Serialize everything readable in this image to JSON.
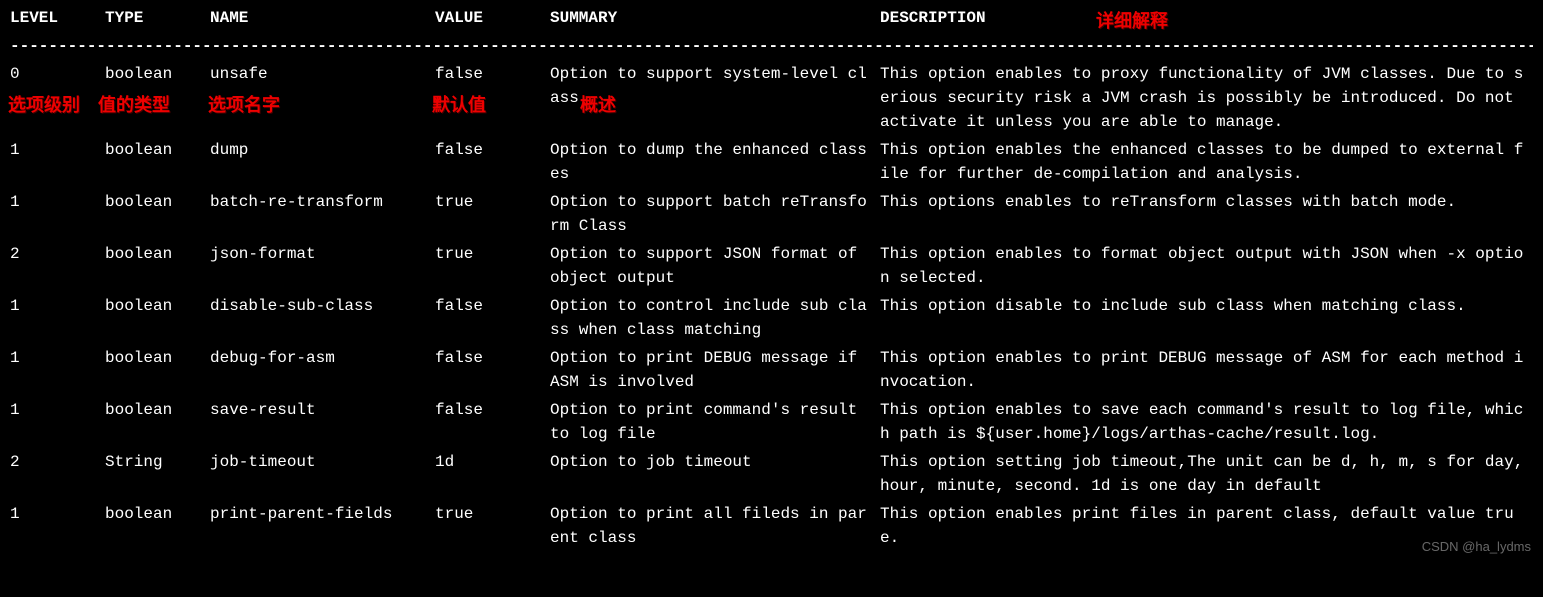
{
  "headers": {
    "level": "LEVEL",
    "type": "TYPE",
    "name": "NAME",
    "value": "VALUE",
    "summary": "SUMMARY",
    "description": "DESCRIPTION"
  },
  "rows": [
    {
      "level": "0",
      "type": "boolean",
      "name": "unsafe",
      "value": "false",
      "summary": "Option to support system-level class",
      "description": "This option enables to proxy functionality of JVM classes. Due to serious security risk a JVM crash is possibly be introduced. Do not activate it unless you are able to manage."
    },
    {
      "level": "1",
      "type": "boolean",
      "name": "dump",
      "value": "false",
      "summary": "Option to dump the enhanced classes",
      "description": "This option enables the enhanced classes to be dumped to external file for further de-compilation and analysis."
    },
    {
      "level": "1",
      "type": "boolean",
      "name": "batch-re-transform",
      "value": "true",
      "summary": "Option to support batch reTransform Class",
      "description": "This options enables to reTransform classes with batch mode."
    },
    {
      "level": "2",
      "type": "boolean",
      "name": "json-format",
      "value": "true",
      "summary": "Option to support JSON format of object output",
      "description": "This option enables to format object output with JSON when -x option selected."
    },
    {
      "level": "1",
      "type": "boolean",
      "name": "disable-sub-class",
      "value": "false",
      "summary": "Option to control include sub class when class matching",
      "description": "This option disable to include sub class when matching class."
    },
    {
      "level": "1",
      "type": "boolean",
      "name": "debug-for-asm",
      "value": "false",
      "summary": "Option to print DEBUG message if ASM is involved",
      "description": "This option enables to print DEBUG message of ASM for each method invocation."
    },
    {
      "level": "1",
      "type": "boolean",
      "name": "save-result",
      "value": "false",
      "summary": "Option to print command's result to log file",
      "description": "This option enables to save each command's result to log file, which path is ${user.home}/logs/arthas-cache/result.log."
    },
    {
      "level": "2",
      "type": "String",
      "name": "job-timeout",
      "value": "1d",
      "summary": "Option to job timeout",
      "description": "This option setting job timeout,The unit can be d, h, m, s for day, hour, minute, second. 1d is one day in default"
    },
    {
      "level": "1",
      "type": "boolean",
      "name": "print-parent-fields",
      "value": "true",
      "summary": "Option to print all fileds in parent class",
      "description": "This option enables print files in parent class, default value true."
    }
  ],
  "annotations": {
    "level": "选项级别",
    "type": "值的类型",
    "name": "选项名字",
    "value": "默认值",
    "summary": "概述",
    "description": "详细解释"
  },
  "watermark": "CSDN @ha_lydms",
  "dashes": "------------------------------------------------------------------------------------------------------------------------------------------------------------------------"
}
